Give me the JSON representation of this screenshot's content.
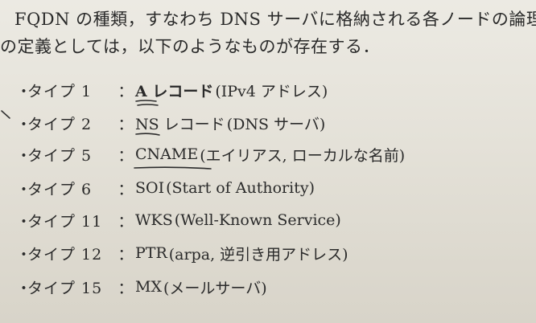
{
  "intro": {
    "line1": "FQDN の種類，すなわち DNS サーバに格納される各ノードの論理",
    "line2": "の定義としては，以下のようなものが存在する．"
  },
  "list": {
    "bullet": "・",
    "colon": "：",
    "items": [
      {
        "type_label": "タイプ 1",
        "record": "A レコード",
        "desc": "(IPv4 アドレス)"
      },
      {
        "type_label": "タイプ 2",
        "record": "NS レコード",
        "desc": "(DNS サーバ)"
      },
      {
        "type_label": "タイプ 5",
        "record": "CNAME",
        "desc": "(エイリアス, ローカルな名前)"
      },
      {
        "type_label": "タイプ 6",
        "record": "SOI",
        "desc": "(Start of Authority)"
      },
      {
        "type_label": "タイプ 11",
        "record": "WKS",
        "desc": "(Well-Known Service)"
      },
      {
        "type_label": "タイプ 12",
        "record": "PTR",
        "desc": "(arpa, 逆引き用アドレス)"
      },
      {
        "type_label": "タイプ 15",
        "record": "MX",
        "desc": "(メールサーバ)"
      }
    ]
  },
  "colors": {
    "text": "#2a2a2a",
    "ink": "#2b2b2b",
    "paper": "#e3e0d6"
  }
}
